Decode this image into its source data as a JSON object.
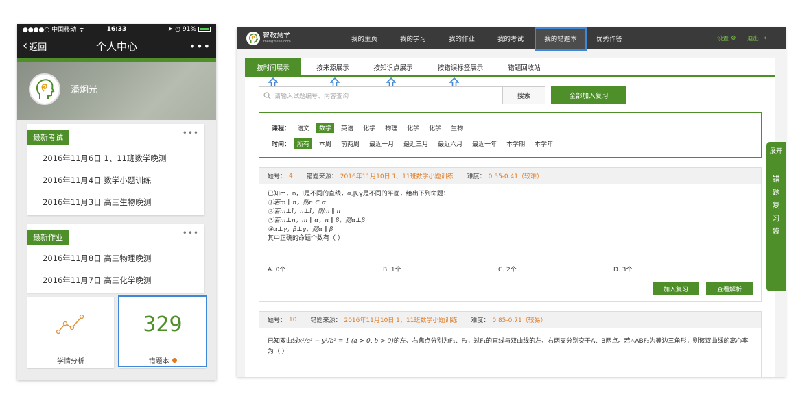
{
  "phone": {
    "status": {
      "carrier": "●●●●○ 中国移动",
      "time": "16:33",
      "battery": "91%"
    },
    "nav": {
      "back": "返回",
      "title": "个人中心",
      "more": "•••"
    },
    "user": {
      "name": "潘炯光"
    },
    "exams": {
      "tag": "最新考试",
      "more": "•••",
      "items": [
        "2016年11月6日 1、11班数学晚测",
        "2016年11月4日 数学小题训练",
        "2016年11月3日 高三生物晚测"
      ]
    },
    "homework": {
      "tag": "最新作业",
      "more": "•••",
      "items": [
        "2016年11月8日 高三物理晚测",
        "2016年11月7日 高三化学晚测"
      ]
    },
    "tiles": {
      "analysis_label": "学情分析",
      "wrongbook_label": "错题本",
      "wrongbook_count": "329"
    }
  },
  "web": {
    "logo": {
      "text": "智教慧学",
      "sub": "zhengxiexe.com"
    },
    "nav": [
      "我的主页",
      "我的学习",
      "我的作业",
      "我的考试",
      "我的错题本",
      "优秀作答"
    ],
    "util": {
      "settings": "设置",
      "logout": "退出"
    },
    "tabs": [
      "按时间展示",
      "按来源展示",
      "按知识点展示",
      "按错误标签展示",
      "错题回收站"
    ],
    "search": {
      "placeholder": "请输入试题编号、内容查询",
      "button": "搜索"
    },
    "add_all": "全部加入复习",
    "filter": {
      "course_label": "课程：",
      "courses": [
        "语文",
        "数学",
        "英语",
        "化学",
        "物理",
        "化学",
        "化学",
        "生物"
      ],
      "time_label": "时间：",
      "times": [
        "所有",
        "本周",
        "前两周",
        "最近一月",
        "最近三月",
        "最近六月",
        "最近一年",
        "本学期",
        "本学年"
      ]
    },
    "q1": {
      "num_label": "题号：",
      "num": "4",
      "src_label": "错题来源：",
      "src": "2016年11月10日 1、11班数学小题训练",
      "diff_label": "难度：",
      "diff": "0.55-0.41（较难）",
      "stem": "已知m，n，l是不同的直线，α,β,γ是不同的平面，给出下列命题：",
      "lines": [
        "①若m ∥ n，则n ⊂ α",
        "②若m⊥l，n⊥l，则m ∥ n",
        "③若m⊥n，m ∥ α，n ∥ β，则α⊥β",
        "④α⊥γ，β⊥γ，则α ∥ β"
      ],
      "question": "其中正确的命题个数有（    ）",
      "options": [
        "A. 0个",
        "B. 1个",
        "C. 2个",
        "D. 3个"
      ],
      "add_btn": "加入复习",
      "view_btn": "查看解析"
    },
    "q2": {
      "num_label": "题号：",
      "num": "10",
      "src_label": "错题来源：",
      "src": "2016年11月10日 1、11班数学小题训练",
      "diff_label": "难度：",
      "diff": "0.85-0.71（较易）",
      "stem_pre": "已知双曲线",
      "stem_math": "x²/a² − y²/b² = 1 (a > 0, b > 0)",
      "stem_post": "的左、右焦点分别为F₁、F₂，过F₁的直线与双曲线的左、右两支分别交于A、B两点。若△ABF₂为等边三角形，则该双曲线的离心率",
      "stem_end": "为（    ）"
    },
    "side": {
      "expand": "展开",
      "chars": [
        "错",
        "题",
        "复",
        "习",
        "袋"
      ]
    }
  }
}
